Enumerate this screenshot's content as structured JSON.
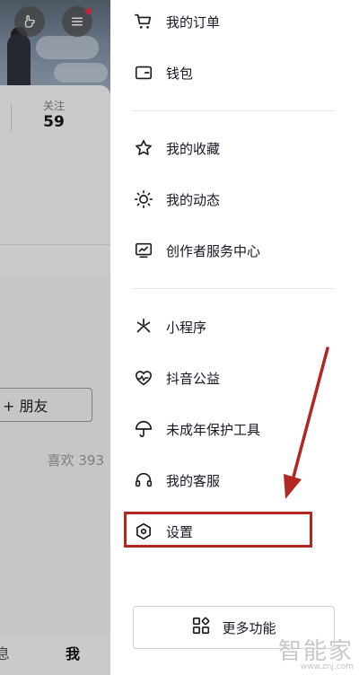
{
  "profile": {
    "follow_label": "关注",
    "follow_count": "59",
    "friend_button": "+ 朋友",
    "likes": "喜欢 393",
    "nav": {
      "messages": "息",
      "me": "我"
    }
  },
  "drawer": {
    "items": [
      {
        "label": "我的订单",
        "icon": "cart-icon"
      },
      {
        "label": "钱包",
        "icon": "wallet-icon"
      },
      {
        "label": "我的收藏",
        "icon": "star-icon"
      },
      {
        "label": "我的动态",
        "icon": "sun-icon"
      },
      {
        "label": "创作者服务中心",
        "icon": "monitor-chart-icon"
      },
      {
        "label": "小程序",
        "icon": "mini-program-icon"
      },
      {
        "label": "抖音公益",
        "icon": "heart-pulse-icon"
      },
      {
        "label": "未成年保护工具",
        "icon": "umbrella-icon"
      },
      {
        "label": "我的客服",
        "icon": "headset-icon"
      },
      {
        "label": "设置",
        "icon": "hexagon-settings-icon"
      }
    ],
    "more_button": "更多功能"
  },
  "annotation": {
    "highlight_color": "#b12821"
  },
  "watermark": {
    "line1": "智能家",
    "line2": "www.znj.com"
  }
}
